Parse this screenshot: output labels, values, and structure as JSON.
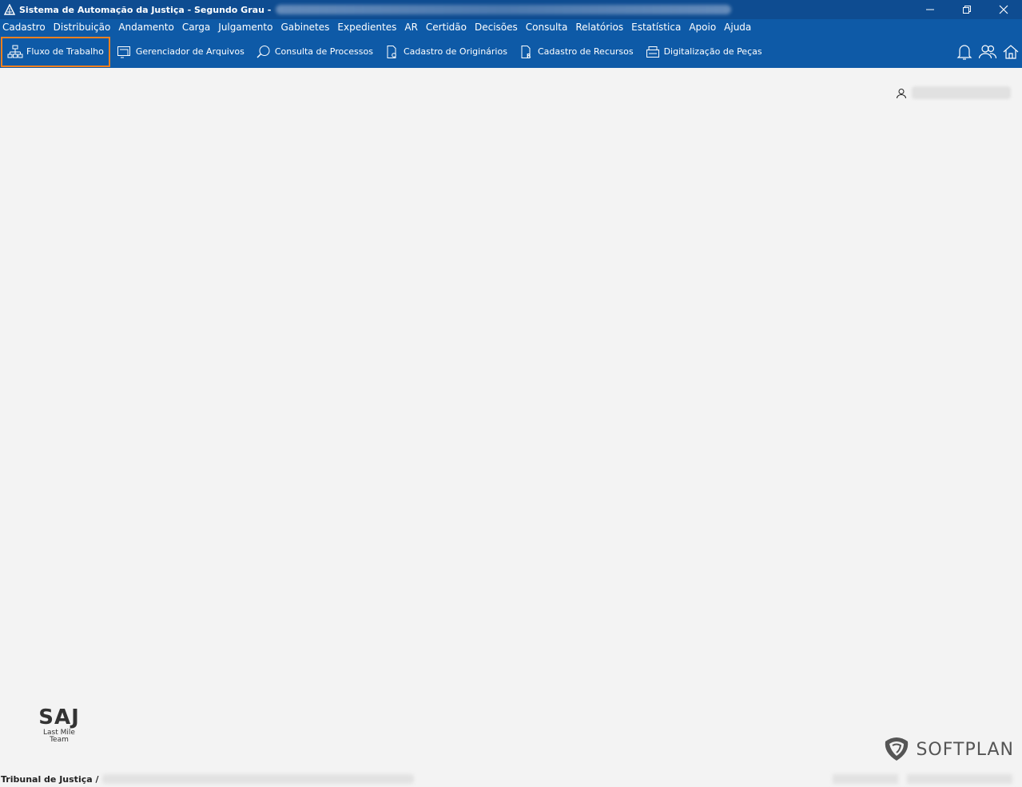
{
  "window": {
    "title": "Sistema de Automação da Justiça - Segundo Grau -"
  },
  "menu": {
    "items": [
      "Cadastro",
      "Distribuição",
      "Andamento",
      "Carga",
      "Julgamento",
      "Gabinetes",
      "Expedientes",
      "AR",
      "Certidão",
      "Decisões",
      "Consulta",
      "Relatórios",
      "Estatística",
      "Apoio",
      "Ajuda"
    ]
  },
  "toolbar": {
    "items": [
      {
        "label": "Fluxo de Trabalho",
        "icon": "workflow-icon"
      },
      {
        "label": "Gerenciador de Arquivos",
        "icon": "file-manager-icon"
      },
      {
        "label": "Consulta de Processos",
        "icon": "search-process-icon"
      },
      {
        "label": "Cadastro de Originários",
        "icon": "originals-icon"
      },
      {
        "label": "Cadastro de Recursos",
        "icon": "appeals-icon"
      },
      {
        "label": "Digitalização de Peças",
        "icon": "scanner-icon"
      }
    ],
    "right_icons": [
      "bell-icon",
      "users-icon",
      "home-icon"
    ]
  },
  "branding": {
    "saj_mark": "SAJ",
    "saj_sub1": "Last Mile",
    "saj_sub2": "Team",
    "softplan": "SOFTPLAN"
  },
  "status": {
    "left_text": "Tribunal de Justiça /"
  },
  "colors": {
    "titlebar": "#0e4c91",
    "menubar": "#0e5aa7",
    "active_outline": "#f0801e",
    "background": "#f3f3f3"
  }
}
